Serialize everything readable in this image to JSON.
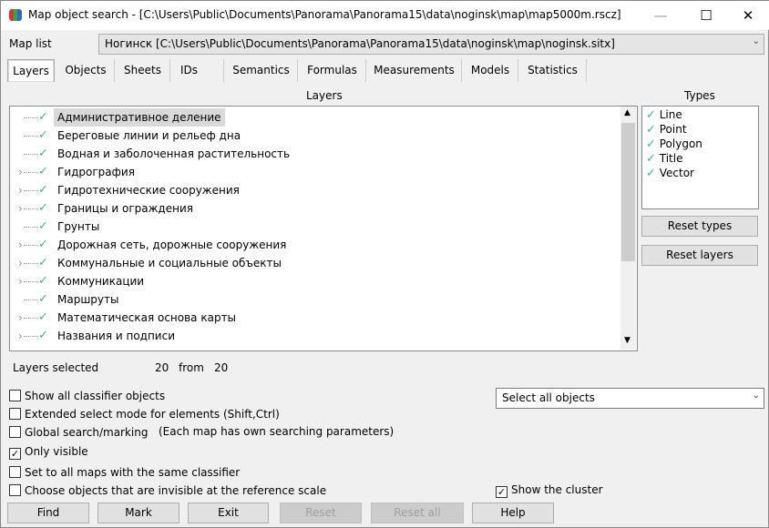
{
  "window": {
    "title": "Map object search - [C:\\Users\\Public\\Documents\\Panorama\\Panorama15\\data\\noginsk\\map\\map5000m.rscz]"
  },
  "map_list": {
    "label": "Map list",
    "value": "Ногинск [C:\\Users\\Public\\Documents\\Panorama\\Panorama15\\data\\noginsk\\map\\noginsk.sitx]"
  },
  "tabs": [
    {
      "label": "Layers",
      "active": true
    },
    {
      "label": "Objects"
    },
    {
      "label": "Sheets"
    },
    {
      "label": "IDs"
    },
    {
      "label": "Semantics"
    },
    {
      "label": "Formulas"
    },
    {
      "label": "Measurements"
    },
    {
      "label": "Models"
    },
    {
      "label": "Statistics"
    }
  ],
  "layers": {
    "header": "Layers",
    "items": [
      {
        "label": "Административное деление",
        "expandable": false,
        "checked": true,
        "selected": true
      },
      {
        "label": "Береговые линии и рельеф дна",
        "expandable": false,
        "checked": true
      },
      {
        "label": "Водная и заболоченная растительность",
        "expandable": false,
        "checked": true
      },
      {
        "label": "Гидрография",
        "expandable": true,
        "checked": true
      },
      {
        "label": "Гидротехнические сооружения",
        "expandable": true,
        "checked": true
      },
      {
        "label": "Границы и ограждения",
        "expandable": true,
        "checked": true
      },
      {
        "label": "Грунты",
        "expandable": false,
        "checked": true
      },
      {
        "label": "Дорожная сеть, дорожные сооружения",
        "expandable": true,
        "checked": true
      },
      {
        "label": "Коммунальные и социальные объекты",
        "expandable": true,
        "checked": true
      },
      {
        "label": "Коммуникации",
        "expandable": true,
        "checked": true
      },
      {
        "label": "Маршруты",
        "expandable": false,
        "checked": true
      },
      {
        "label": "Математическая основа карты",
        "expandable": true,
        "checked": true
      },
      {
        "label": "Названия и подписи",
        "expandable": true,
        "checked": true
      }
    ]
  },
  "types": {
    "header": "Types",
    "items": [
      "Line",
      "Point",
      "Polygon",
      "Title",
      "Vector"
    ]
  },
  "reset_types": "Reset types",
  "reset_layers": "Reset layers",
  "status": {
    "label": "Layers selected",
    "selected": "20",
    "from_label": "from",
    "total": "20"
  },
  "options": [
    {
      "label": "Show all classifier objects",
      "checked": false
    },
    {
      "label": "Extended select mode for elements (Shift,Ctrl)",
      "checked": false
    },
    {
      "label": "Global search/marking",
      "checked": false
    },
    {
      "label": "Only visible",
      "checked": true
    },
    {
      "label": "Set to all maps with the same classifier",
      "checked": false
    },
    {
      "label": "Choose objects that are invisible at the reference scale",
      "checked": false
    }
  ],
  "global_note": "(Each map has own searching parameters)",
  "select_mode": "Select all objects",
  "show_cluster": {
    "label": "Show the cluster",
    "checked": true
  },
  "buttons": {
    "find": "Find",
    "mark": "Mark",
    "exit": "Exit",
    "reset": "Reset",
    "reset_all": "Reset all",
    "help": "Help"
  }
}
